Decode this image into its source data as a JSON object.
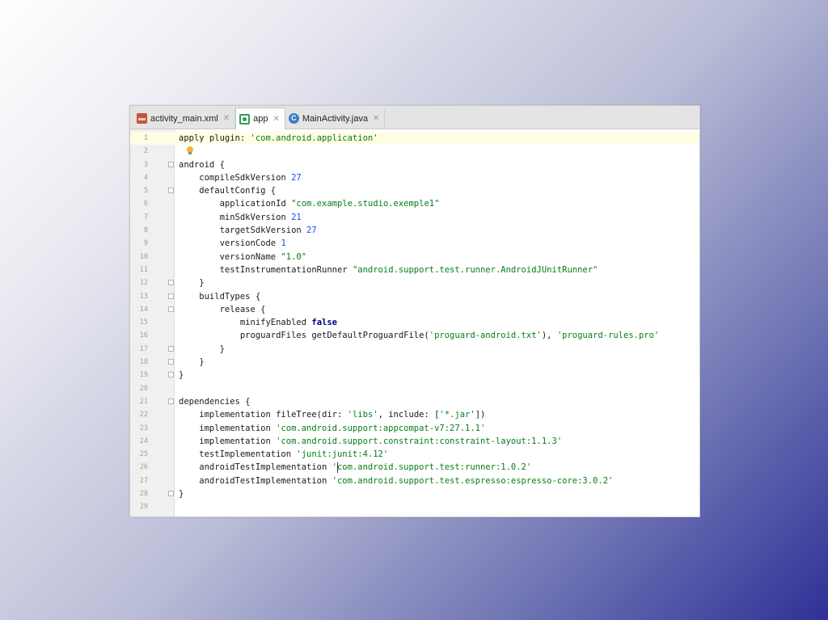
{
  "tabs": [
    {
      "label": "activity_main.xml",
      "icon": "xml-file-icon",
      "active": false
    },
    {
      "label": "app",
      "icon": "gradle-icon",
      "active": true
    },
    {
      "label": "MainActivity.java",
      "icon": "java-class-icon",
      "active": false
    }
  ],
  "editor": {
    "current_line": 1,
    "lines": [
      {
        "n": "1",
        "text": "apply plugin: 'com.android.application'"
      },
      {
        "n": "2",
        "text": ""
      },
      {
        "n": "3",
        "text": "android {"
      },
      {
        "n": "4",
        "text": "    compileSdkVersion 27"
      },
      {
        "n": "5",
        "text": "    defaultConfig {"
      },
      {
        "n": "6",
        "text": "        applicationId \"com.example.studio.exemple1\""
      },
      {
        "n": "7",
        "text": "        minSdkVersion 21"
      },
      {
        "n": "8",
        "text": "        targetSdkVersion 27"
      },
      {
        "n": "9",
        "text": "        versionCode 1"
      },
      {
        "n": "10",
        "text": "        versionName \"1.0\""
      },
      {
        "n": "11",
        "text": "        testInstrumentationRunner \"android.support.test.runner.AndroidJUnitRunner\""
      },
      {
        "n": "12",
        "text": "    }"
      },
      {
        "n": "13",
        "text": "    buildTypes {"
      },
      {
        "n": "14",
        "text": "        release {"
      },
      {
        "n": "15",
        "text": "            minifyEnabled false"
      },
      {
        "n": "16",
        "text": "            proguardFiles getDefaultProguardFile('proguard-android.txt'), 'proguard-rules.pro'"
      },
      {
        "n": "17",
        "text": "        }"
      },
      {
        "n": "18",
        "text": "    }"
      },
      {
        "n": "19",
        "text": "}"
      },
      {
        "n": "20",
        "text": ""
      },
      {
        "n": "21",
        "text": "dependencies {"
      },
      {
        "n": "22",
        "text": "    implementation fileTree(dir: 'libs', include: ['*.jar'])"
      },
      {
        "n": "23",
        "text": "    implementation 'com.android.support:appcompat-v7:27.1.1'"
      },
      {
        "n": "24",
        "text": "    implementation 'com.android.support.constraint:constraint-layout:1.1.3'"
      },
      {
        "n": "25",
        "text": "    testImplementation 'junit:junit:4.12'"
      },
      {
        "n": "26",
        "text": "    androidTestImplementation 'com.android.support.test:runner:1.0.2'"
      },
      {
        "n": "27",
        "text": "    androidTestImplementation 'com.android.support.test.espresso:espresso-core:3.0.2'"
      },
      {
        "n": "28",
        "text": "}"
      },
      {
        "n": "29",
        "text": ""
      }
    ]
  },
  "colors": {
    "string": "#067d17",
    "number": "#1750eb",
    "keyword": "#000080",
    "current_line": "#fffde4"
  }
}
